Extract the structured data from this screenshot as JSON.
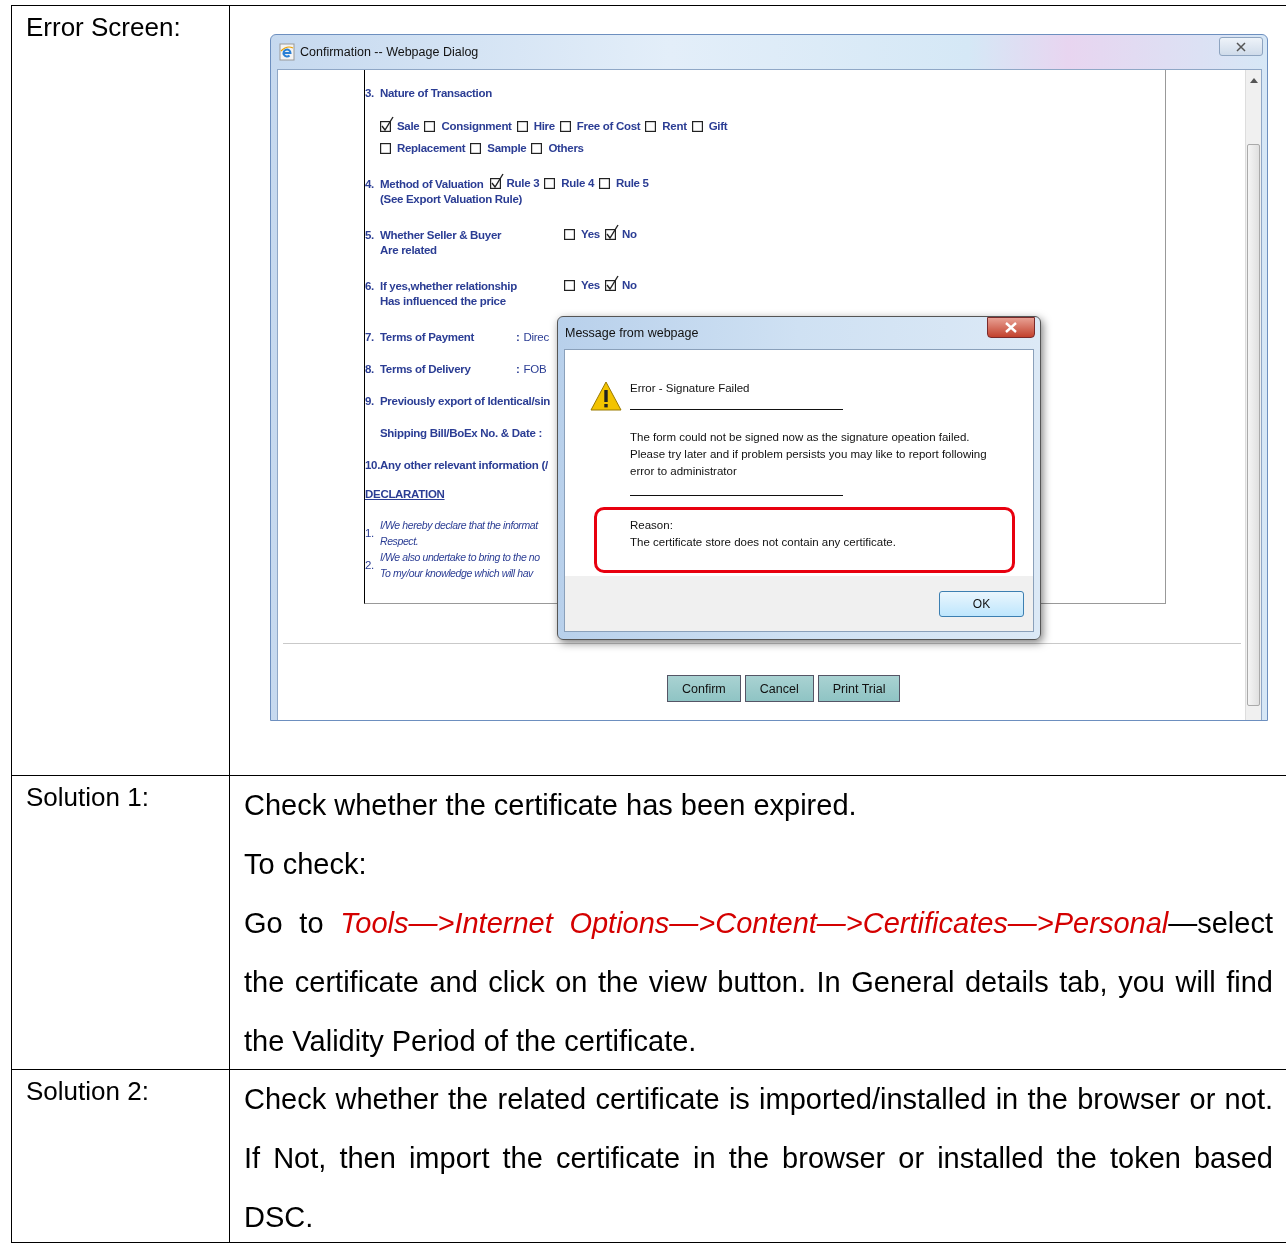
{
  "rows": [
    {
      "label": "Error Screen:",
      "kind": "screenshot"
    },
    {
      "label": "Solution 1:",
      "kind": "text",
      "paragraphs": [
        "Check whether the certificate has been expired.",
        "To check:",
        "Go to *Tools—>Internet  Options—>Content—>Certificates—>Personal*—select the certificate and click on the view button. In General details tab, you will find the Validity Period of the certificate."
      ]
    },
    {
      "label": "Solution 2:",
      "kind": "text",
      "paragraphs": [
        "Check whether the related certificate is imported/installed in the browser or not. If Not, then import the certificate in the browser or installed the token based DSC."
      ]
    }
  ],
  "dialog": {
    "title": "Confirmation -- Webpage Dialog",
    "form": {
      "items": [
        {
          "kind": "option-rows",
          "number": "3.",
          "label": "Nature of Transaction",
          "option_rows": [
            [
              {
                "label": "Sale",
                "checked": true
              },
              {
                "label": "Consignment",
                "checked": false
              },
              {
                "label": "Hire",
                "checked": false
              },
              {
                "label": "Free of Cost",
                "checked": false
              },
              {
                "label": "Rent",
                "checked": false
              },
              {
                "label": "Gift",
                "checked": false
              }
            ],
            [
              {
                "label": "Replacement",
                "checked": false
              },
              {
                "label": "Sample",
                "checked": false
              },
              {
                "label": "Others",
                "checked": false
              }
            ]
          ]
        },
        {
          "kind": "inline-options",
          "number": "4.",
          "label": "Method of Valuation",
          "sublabel": "(See Export Valuation Rule)",
          "options": [
            {
              "label": "Rule 3",
              "checked": true
            },
            {
              "label": "Rule 4",
              "checked": false
            },
            {
              "label": "Rule 5",
              "checked": false
            }
          ]
        },
        {
          "kind": "side-options",
          "number": "5.",
          "label": "Whether Seller & Buyer",
          "sublabel": "Are related",
          "options": [
            {
              "label": "Yes",
              "checked": false
            },
            {
              "label": "No",
              "checked": true
            }
          ]
        },
        {
          "kind": "side-options",
          "number": "6.",
          "label": "If yes,whether relationship",
          "sublabel": "Has influenced the price",
          "options": [
            {
              "label": "Yes",
              "checked": false
            },
            {
              "label": "No",
              "checked": true
            }
          ]
        },
        {
          "kind": "field",
          "number": "7.",
          "label": "Terms of Payment",
          "separator": ":",
          "value": "Direc"
        },
        {
          "kind": "field",
          "number": "8.",
          "label": "Terms of Delivery",
          "separator": ":",
          "value": "FOB"
        },
        {
          "kind": "line",
          "number": "9.",
          "label": "Previously export of Identical/sin"
        },
        {
          "kind": "line",
          "label": "Shipping Bill/BoEx No. & Date :"
        },
        {
          "kind": "line",
          "number": "10.",
          "label": "Any other relevant information (/"
        },
        {
          "kind": "heading",
          "label": "DECLARATION"
        },
        {
          "kind": "declaration",
          "number": "1.",
          "lines": [
            "I/We hereby declare that the informat",
            "Respect."
          ]
        },
        {
          "kind": "declaration",
          "number": "2.",
          "lines": [
            "I/We also undertake to bring to the no",
            "To my/our knowledge which will hav"
          ]
        }
      ]
    },
    "buttons": [
      "Confirm",
      "Cancel",
      "Print Trial"
    ],
    "message": {
      "title": "Message from webpage",
      "heading": "Error - Signature Failed",
      "body": "The form could not be signed now as the signature opeation failed. Please try later and if problem persists you may like to report following error to administrator",
      "reason_label": "Reason:",
      "reason": "The certificate store does not contain any certificate.",
      "button": "OK"
    }
  }
}
